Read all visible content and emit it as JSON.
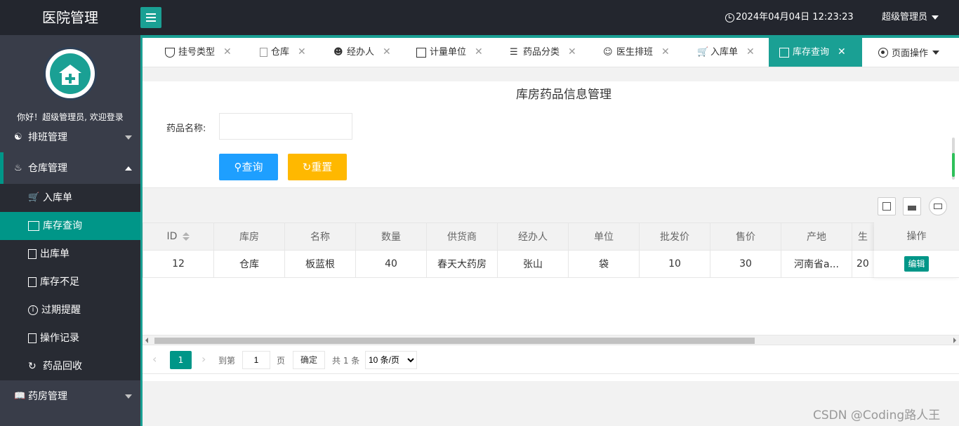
{
  "header": {
    "title": "医院管理",
    "datetime": "2024年04月04日 12:23:23",
    "user": "超级管理员"
  },
  "sidebar": {
    "welcome": "你好！超级管理员, 欢迎登录",
    "groups": [
      {
        "label": "排班管理",
        "icon": "users-icon"
      },
      {
        "label": "仓库管理",
        "icon": "warehouse-icon"
      },
      {
        "label": "药房管理",
        "icon": "book-icon"
      }
    ],
    "items": [
      {
        "label": "入库单",
        "icon": "cart-icon"
      },
      {
        "label": "库存查询",
        "icon": "calendar-icon"
      },
      {
        "label": "出库单",
        "icon": "file-icon"
      },
      {
        "label": "库存不足",
        "icon": "edit-icon"
      },
      {
        "label": "过期提醒",
        "icon": "info-icon"
      },
      {
        "label": "操作记录",
        "icon": "edit-icon"
      },
      {
        "label": "药品回收",
        "icon": "refresh-icon"
      }
    ]
  },
  "tabs": [
    {
      "label": "挂号类型",
      "icon": "shield-icon"
    },
    {
      "label": "仓库",
      "icon": "file-icon"
    },
    {
      "label": "经办人",
      "icon": "user-icon"
    },
    {
      "label": "计量单位",
      "icon": "calendar-icon"
    },
    {
      "label": "药品分类",
      "icon": "layers-icon"
    },
    {
      "label": "医生排班",
      "icon": "user-icon"
    },
    {
      "label": "入库单",
      "icon": "cart-icon"
    },
    {
      "label": "库存查询",
      "icon": "calendar-icon"
    }
  ],
  "page_ops": "页面操作",
  "page": {
    "title": "库房药品信息管理",
    "search_label": "药品名称:",
    "search_value": "",
    "search_button": "查询",
    "reset_button": "重置"
  },
  "table": {
    "columns": [
      "ID",
      "库房",
      "名称",
      "数量",
      "供货商",
      "经办人",
      "单位",
      "批发价",
      "售价",
      "产地",
      "生"
    ],
    "action_header": "操作",
    "rows": [
      {
        "cells": [
          "12",
          "仓库",
          "板蓝根",
          "40",
          "春天大药房",
          "张山",
          "袋",
          "10",
          "30",
          "河南省a...",
          "20"
        ],
        "action": "编辑"
      }
    ]
  },
  "pager": {
    "current": "1",
    "goto_label": "到第",
    "goto_value": "1",
    "page_label": "页",
    "confirm": "确定",
    "total": "共 1 条",
    "page_size": "10 条/页"
  },
  "watermark": "CSDN @Coding路人王",
  "colors": {
    "accent": "#009688",
    "header": "#23262e",
    "sidebar": "#393d49",
    "search": "#1e9fff",
    "reset": "#ffb800"
  }
}
